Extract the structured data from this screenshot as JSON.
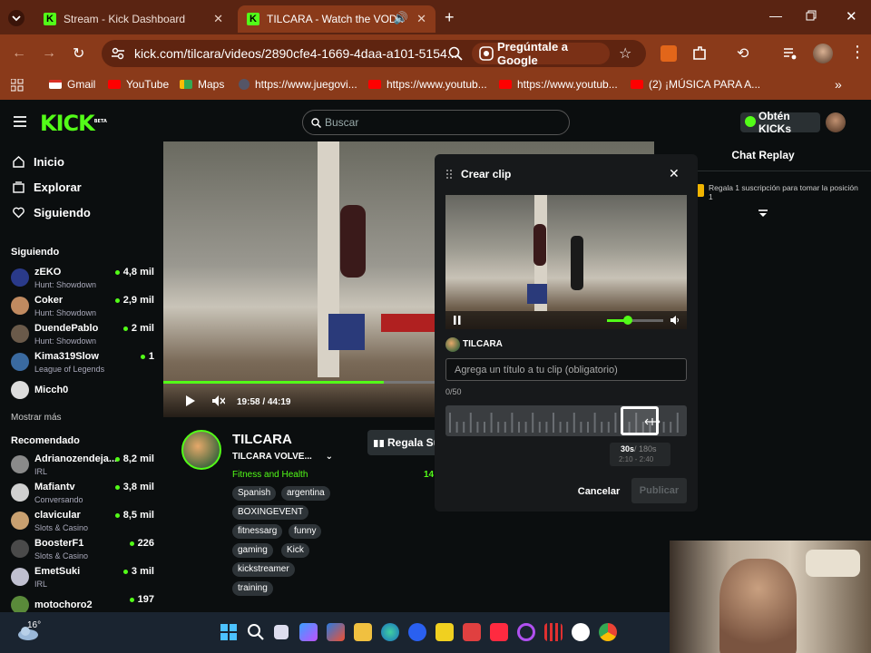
{
  "browser": {
    "tabs": [
      {
        "label": "Stream - Kick Dashboard",
        "favicon": "K"
      },
      {
        "label": "TILCARA - Watch the VOD c",
        "favicon": "K"
      }
    ],
    "url": "kick.com/tilcara/videos/2890cfe4-1669-4daa-a101-5154...",
    "ask_google": "Pregúntale a Google",
    "bookmarks": [
      "Gmail",
      "YouTube",
      "Maps",
      "https://www.juegovi...",
      "https://www.youtub...",
      "https://www.youtub...",
      "(2) ¡MÚSICA PARA A..."
    ]
  },
  "kick": {
    "logo": "KICK",
    "logo_beta": "BETA",
    "search_placeholder": "Buscar",
    "get_kicks": "Obtén KICKs",
    "nav": [
      "Inicio",
      "Explorar",
      "Siguiendo"
    ],
    "following_header": "Siguiendo",
    "following": [
      {
        "name": "zEKO",
        "game": "Hunt: Showdown",
        "viewers": "4,8 mil",
        "color": "#2a3a8a"
      },
      {
        "name": "Coker",
        "game": "Hunt: Showdown",
        "viewers": "2,9 mil",
        "color": "#c08a60"
      },
      {
        "name": "DuendePablo",
        "game": "Hunt: Showdown",
        "viewers": "2 mil",
        "color": "#6a5a4a"
      },
      {
        "name": "Kima319Slow",
        "game": "League of Legends",
        "viewers": "1",
        "color": "#3a6aa0"
      },
      {
        "name": "Micch0",
        "game": "",
        "viewers": "",
        "color": "#ddd"
      }
    ],
    "show_more": "Mostrar más",
    "recommended_header": "Recomendado",
    "recommended": [
      {
        "name": "Adrianozendeja...",
        "game": "IRL",
        "viewers": "8,2 mil",
        "color": "#8a8a8a"
      },
      {
        "name": "Mafiantv",
        "game": "Conversando",
        "viewers": "3,8 mil",
        "color": "#d0d0d0"
      },
      {
        "name": "clavicular",
        "game": "Slots & Casino",
        "viewers": "8,5 mil",
        "color": "#c8a070"
      },
      {
        "name": "BoosterF1",
        "game": "Slots & Casino",
        "viewers": "226",
        "color": "#4a4a4a"
      },
      {
        "name": "EmetSuki",
        "game": "IRL",
        "viewers": "3 mil",
        "color": "#c0c0d0"
      },
      {
        "name": "motochoro2",
        "game": "",
        "viewers": "197",
        "color": "#5a8a3a"
      }
    ],
    "player": {
      "time": "19:58 / 44:19",
      "progress": 0.45
    },
    "channel": {
      "name": "TILCARA",
      "title": "TILCARA VOLVE...",
      "category": "Fitness and Health",
      "viewers": "14",
      "gift_sub": "Regala Su",
      "tags": [
        "Spanish",
        "argentina",
        "BOXINGEVENT",
        "fitnessarg",
        "funny",
        "gaming",
        "Kick",
        "kickstreamer",
        "training"
      ]
    },
    "chat": {
      "title": "Chat Replay",
      "gift_msg": "Regala 1 suscripción para tomar la posición 1"
    },
    "clip_modal": {
      "title": "Crear clip",
      "user": "TILCARA",
      "title_placeholder": "Agrega un título a tu clip (obligatorio)",
      "char_count": "0/50",
      "duration": "30s",
      "max_duration": "/ 180s",
      "range": "2:10 - 2:40",
      "cancel": "Cancelar",
      "publish": "Publicar"
    }
  },
  "taskbar": {
    "temperature": "16°"
  }
}
